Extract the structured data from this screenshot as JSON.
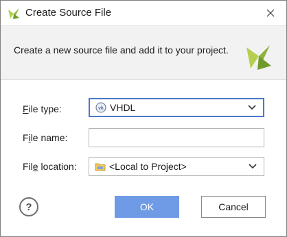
{
  "window": {
    "title": "Create Source File"
  },
  "header": {
    "description": "Create a new source file and add it to your project."
  },
  "form": {
    "file_type": {
      "label_pre": "",
      "label_u": "F",
      "label_post": "ile type:",
      "value": "VHDL",
      "icon": "vhdl-icon"
    },
    "file_name": {
      "label_pre": "F",
      "label_u": "i",
      "label_post": "le name:",
      "value": ""
    },
    "file_location": {
      "label_pre": "Fil",
      "label_u": "e",
      "label_post": " location:",
      "value": "<Local to Project>",
      "icon": "folder-icon"
    }
  },
  "buttons": {
    "help": "?",
    "ok": "OK",
    "cancel": "Cancel"
  },
  "colors": {
    "accent": "#4a78c8",
    "ok_button": "#6f9be6",
    "logo": "#8db43c"
  }
}
